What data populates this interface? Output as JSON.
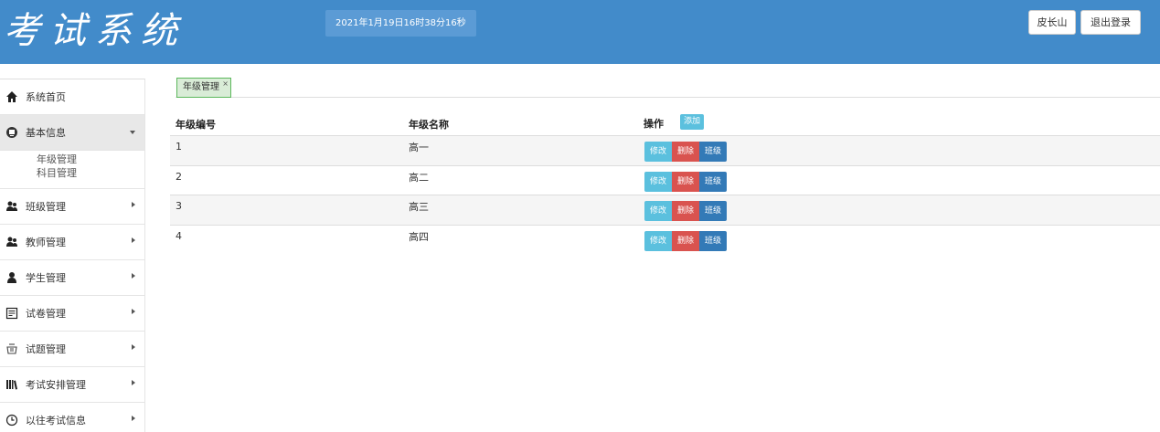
{
  "header": {
    "logo_text": "考试系统",
    "datetime": "2021年1月19日16时38分16秒",
    "user_label": "皮长山",
    "logout_label": "退出登录",
    "bg_color": "#428bca"
  },
  "sidebar": {
    "items": [
      {
        "label": "系统首页",
        "icon": "home-icon"
      },
      {
        "label": "基本信息",
        "icon": "info-icon",
        "expanded": true,
        "children": [
          "年级管理",
          "科目管理"
        ]
      },
      {
        "label": "班级管理",
        "icon": "users-icon"
      },
      {
        "label": "教师管理",
        "icon": "users-icon"
      },
      {
        "label": "学生管理",
        "icon": "user-icon"
      },
      {
        "label": "试卷管理",
        "icon": "paper-icon"
      },
      {
        "label": "试题管理",
        "icon": "question-icon"
      },
      {
        "label": "考试安排管理",
        "icon": "books-icon"
      },
      {
        "label": "以往考试信息",
        "icon": "clock-icon"
      }
    ]
  },
  "tabs": [
    {
      "label": "年级管理",
      "close": "×"
    }
  ],
  "table": {
    "headers": [
      "年级编号",
      "年级名称",
      "操作"
    ],
    "add_label": "添加",
    "rows": [
      {
        "id": "1",
        "name": "高一"
      },
      {
        "id": "2",
        "name": "高二"
      },
      {
        "id": "3",
        "name": "高三"
      },
      {
        "id": "4",
        "name": "高四"
      }
    ],
    "edit_label": "修改",
    "delete_label": "删除",
    "class_label": "班级"
  },
  "colors": {
    "info": "#5bc0de",
    "danger": "#d9534f",
    "primary": "#337ab7",
    "tab_green": "#5cb85c"
  }
}
